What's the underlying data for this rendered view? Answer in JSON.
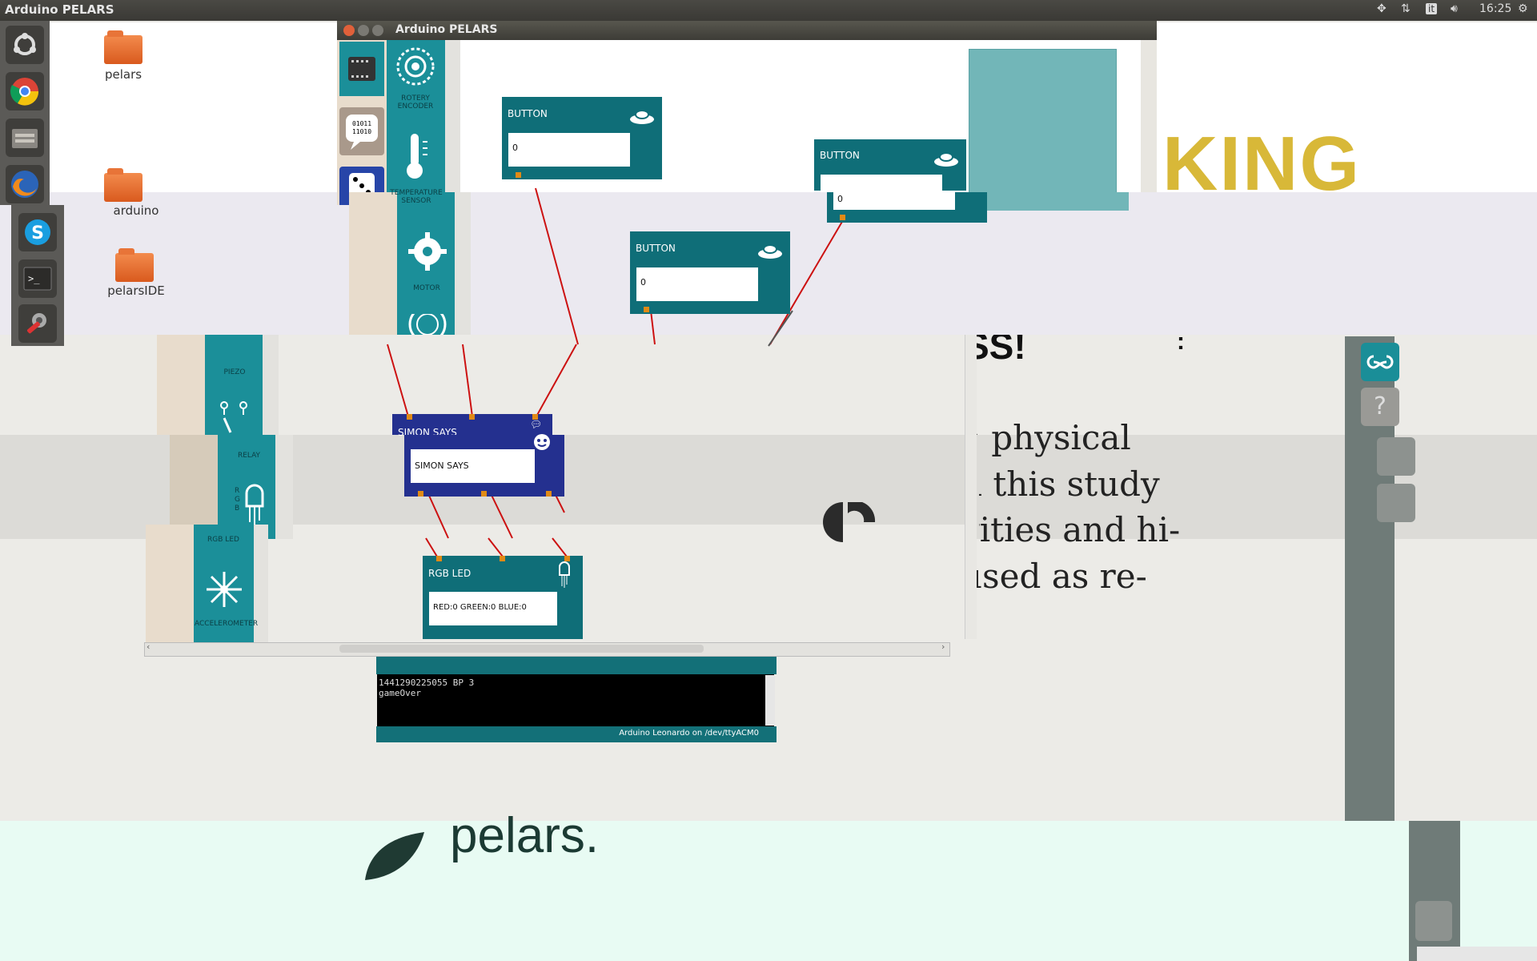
{
  "top_panel": {
    "title": "Arduino PELARS",
    "keyboard_layout": "it",
    "clock": "16:25"
  },
  "desktop": {
    "icons": [
      {
        "label": "pelars"
      },
      {
        "label": "arduino"
      },
      {
        "label": "pelarsIDE"
      }
    ]
  },
  "launcher": {
    "items": [
      "ubuntu-dash",
      "chrome",
      "files",
      "firefox",
      "skype",
      "terminal",
      "system-settings"
    ]
  },
  "window": {
    "title": "Arduino PELARS"
  },
  "palette": {
    "items": [
      {
        "label": "ROTERY\nENCODER"
      },
      {
        "label": "TEMPERATURE\nSENSOR"
      },
      {
        "label": "MOTOR"
      },
      {
        "label": "PIEZO"
      },
      {
        "label": "RELAY"
      },
      {
        "label": "RGB LED"
      },
      {
        "label": "ACCELEROMETER"
      }
    ],
    "rgb_letters": "R\nG\nB"
  },
  "blocks": {
    "button1": {
      "title": "BUTTON",
      "value": "0"
    },
    "button2": {
      "title": "BUTTON",
      "value": "0"
    },
    "button3": {
      "title": "BUTTON",
      "value": "0"
    },
    "simon_header": {
      "title": "SIMON SAYS"
    },
    "simon": {
      "value": "SIMON SAYS"
    },
    "rgb_led": {
      "title": "RGB LED",
      "value": "RED:0 GREEN:0 BLUE:0"
    }
  },
  "console": {
    "lines": [
      "1441290225055 BP 3",
      "gameOver"
    ],
    "status": "Arduino Leonardo on /dev/ttyACM0"
  },
  "website": {
    "heading_fragment": "KING",
    "heading2_fragment": "SS!",
    "body_lines": [
      "e physical",
      "n this study",
      "vities and hi-",
      "used as re-"
    ],
    "logo_text": "pelars."
  },
  "colors": {
    "teal": "#0f6e78",
    "simon_blue": "#24308f",
    "port_orange": "#e08a16",
    "wire_red": "#cc1111"
  }
}
